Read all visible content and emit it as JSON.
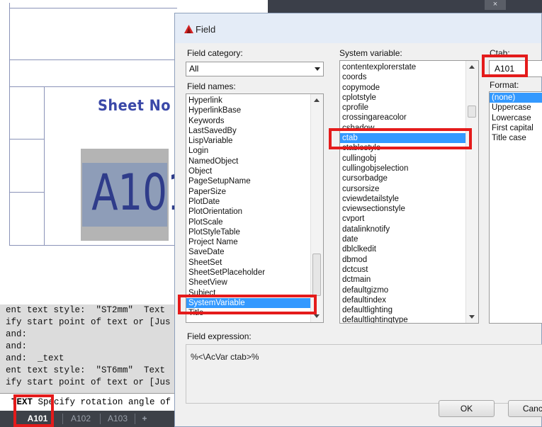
{
  "drawing": {
    "title_text": "Sheet No",
    "sheet_number": "A101"
  },
  "command_line": {
    "history": [
      "ent text style:  \"ST2mm\"  Text",
      "ify start point of text or [Jus",
      "and:",
      "and:",
      "and:  _text",
      "ent text style:  \"ST6mm\"  Text",
      "ify start point of text or [Jus"
    ],
    "prompt_keyword": "TEXT",
    "prompt_text": " Specify rotation angle of"
  },
  "layout_tabs": {
    "tabs": [
      "A101",
      "A102",
      "A103"
    ],
    "active": "A101",
    "add_glyph": "+"
  },
  "dialog": {
    "title": "Field",
    "close_glyph": "×",
    "field_category_label": "Field category:",
    "field_category_value": "All",
    "field_names_label": "Field names:",
    "field_names": [
      "Hyperlink",
      "HyperlinkBase",
      "Keywords",
      "LastSavedBy",
      "LispVariable",
      "Login",
      "NamedObject",
      "Object",
      "PageSetupName",
      "PaperSize",
      "PlotDate",
      "PlotOrientation",
      "PlotScale",
      "PlotStyleTable",
      "Project Name",
      "SaveDate",
      "SheetSet",
      "SheetSetPlaceholder",
      "SheetView",
      "Subject",
      "SystemVariable",
      "Title"
    ],
    "field_names_selected": "SystemVariable",
    "system_variable_label": "System variable:",
    "system_variables": [
      "contentexplorerstate",
      "coords",
      "copymode",
      "cplotstyle",
      "cprofile",
      "crossingareacolor",
      "cshadow",
      "ctab",
      "ctablestyle",
      "cullingobj",
      "cullingobjselection",
      "cursorbadge",
      "cursorsize",
      "cviewdetailstyle",
      "cviewsectionstyle",
      "cvport",
      "datalinknotify",
      "date",
      "dblclkedit",
      "dbmod",
      "dctcust",
      "dctmain",
      "defaultgizmo",
      "defaultindex",
      "defaultlighting",
      "defaultlightingtype"
    ],
    "system_variable_selected": "ctab",
    "value_label": "Ctab:",
    "value": "A101",
    "format_label": "Format:",
    "formats": [
      "(none)",
      "Uppercase",
      "Lowercase",
      "First capital",
      "Title case"
    ],
    "format_selected": "(none)",
    "field_expression_label": "Field expression:",
    "field_expression": "%<\\AcVar ctab>%",
    "ok_label": "OK",
    "cancel_label": "Cancel"
  },
  "colors": {
    "highlight": "#e41b1b",
    "selection": "#3399ff",
    "drawing_text": "#3a48a8",
    "tab_bar": "#3d4148"
  }
}
